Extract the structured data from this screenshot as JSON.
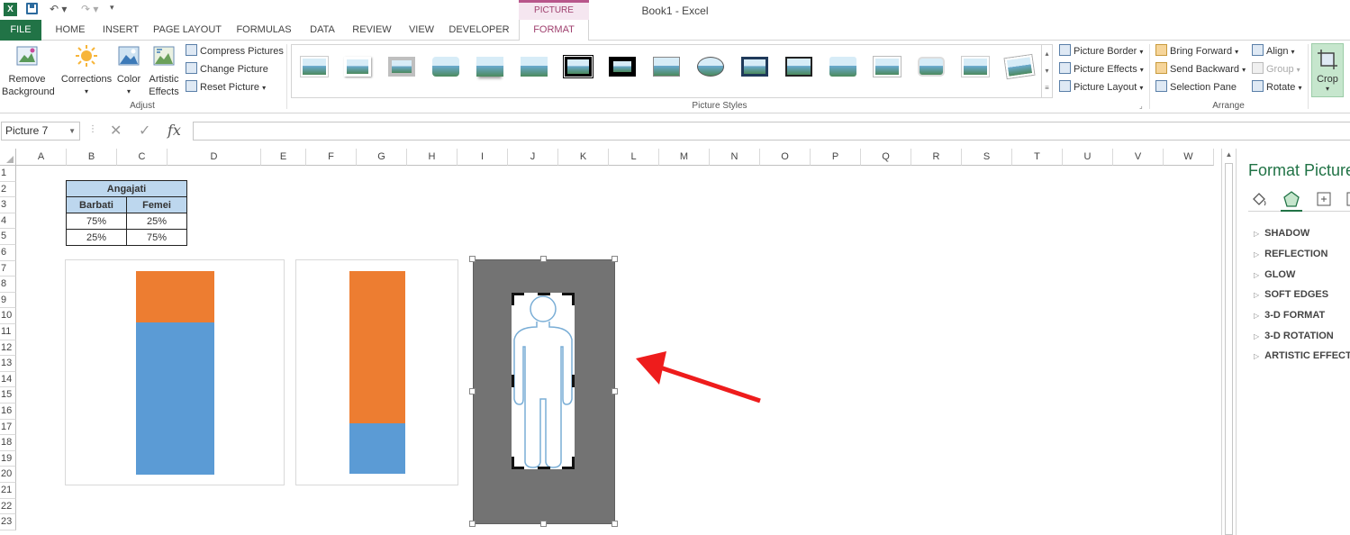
{
  "window": {
    "title": "Book1 - Excel",
    "context_tab_header": "PICTURE TOOLS"
  },
  "tabs": [
    "FILE",
    "HOME",
    "INSERT",
    "PAGE LAYOUT",
    "FORMULAS",
    "DATA",
    "REVIEW",
    "VIEW",
    "DEVELOPER",
    "FORMAT"
  ],
  "ribbon": {
    "adjust": {
      "remove_background": "Remove Background",
      "corrections": "Corrections",
      "color": "Color",
      "artistic_effects": "Artistic Effects",
      "compress": "Compress Pictures",
      "change": "Change Picture",
      "reset": "Reset Picture",
      "label": "Adjust"
    },
    "styles": {
      "border": "Picture Border",
      "effects": "Picture Effects",
      "layout": "Picture Layout",
      "label": "Picture Styles"
    },
    "arrange": {
      "bring_forward": "Bring Forward",
      "send_backward": "Send Backward",
      "selection_pane": "Selection Pane",
      "align": "Align",
      "group": "Group",
      "rotate": "Rotate",
      "label": "Arrange"
    },
    "crop": "Crop"
  },
  "formula_bar": {
    "name_box": "Picture 7",
    "value": ""
  },
  "columns": [
    "A",
    "B",
    "C",
    "D",
    "E",
    "F",
    "G",
    "H",
    "I",
    "J",
    "K",
    "L",
    "M",
    "N",
    "O",
    "P",
    "Q",
    "R",
    "S",
    "T",
    "U",
    "V",
    "W"
  ],
  "rows": [
    "1",
    "2",
    "3",
    "4",
    "5",
    "6",
    "7",
    "8",
    "9",
    "10",
    "11",
    "12",
    "13",
    "14",
    "15",
    "16",
    "17",
    "18",
    "19",
    "20",
    "21",
    "22",
    "23"
  ],
  "table": {
    "title": "Angajati",
    "headers": [
      "Barbati",
      "Femei"
    ],
    "rows": [
      [
        "75%",
        "25%"
      ],
      [
        "25%",
        "75%"
      ]
    ]
  },
  "chart_data": [
    {
      "type": "bar",
      "stacked": true,
      "series": [
        {
          "values": [
            75
          ],
          "color": "#5b9bd5"
        },
        {
          "values": [
            25
          ],
          "color": "#ed7d31"
        }
      ],
      "ylim": [
        0,
        100
      ]
    },
    {
      "type": "bar",
      "stacked": true,
      "series": [
        {
          "values": [
            25
          ],
          "color": "#5b9bd5"
        },
        {
          "values": [
            75
          ],
          "color": "#ed7d31"
        }
      ],
      "ylim": [
        0,
        100
      ]
    }
  ],
  "format_pane": {
    "title": "Format Picture",
    "items": [
      "SHADOW",
      "REFLECTION",
      "GLOW",
      "SOFT EDGES",
      "3-D FORMAT",
      "3-D ROTATION",
      "ARTISTIC EFFECTS"
    ]
  }
}
